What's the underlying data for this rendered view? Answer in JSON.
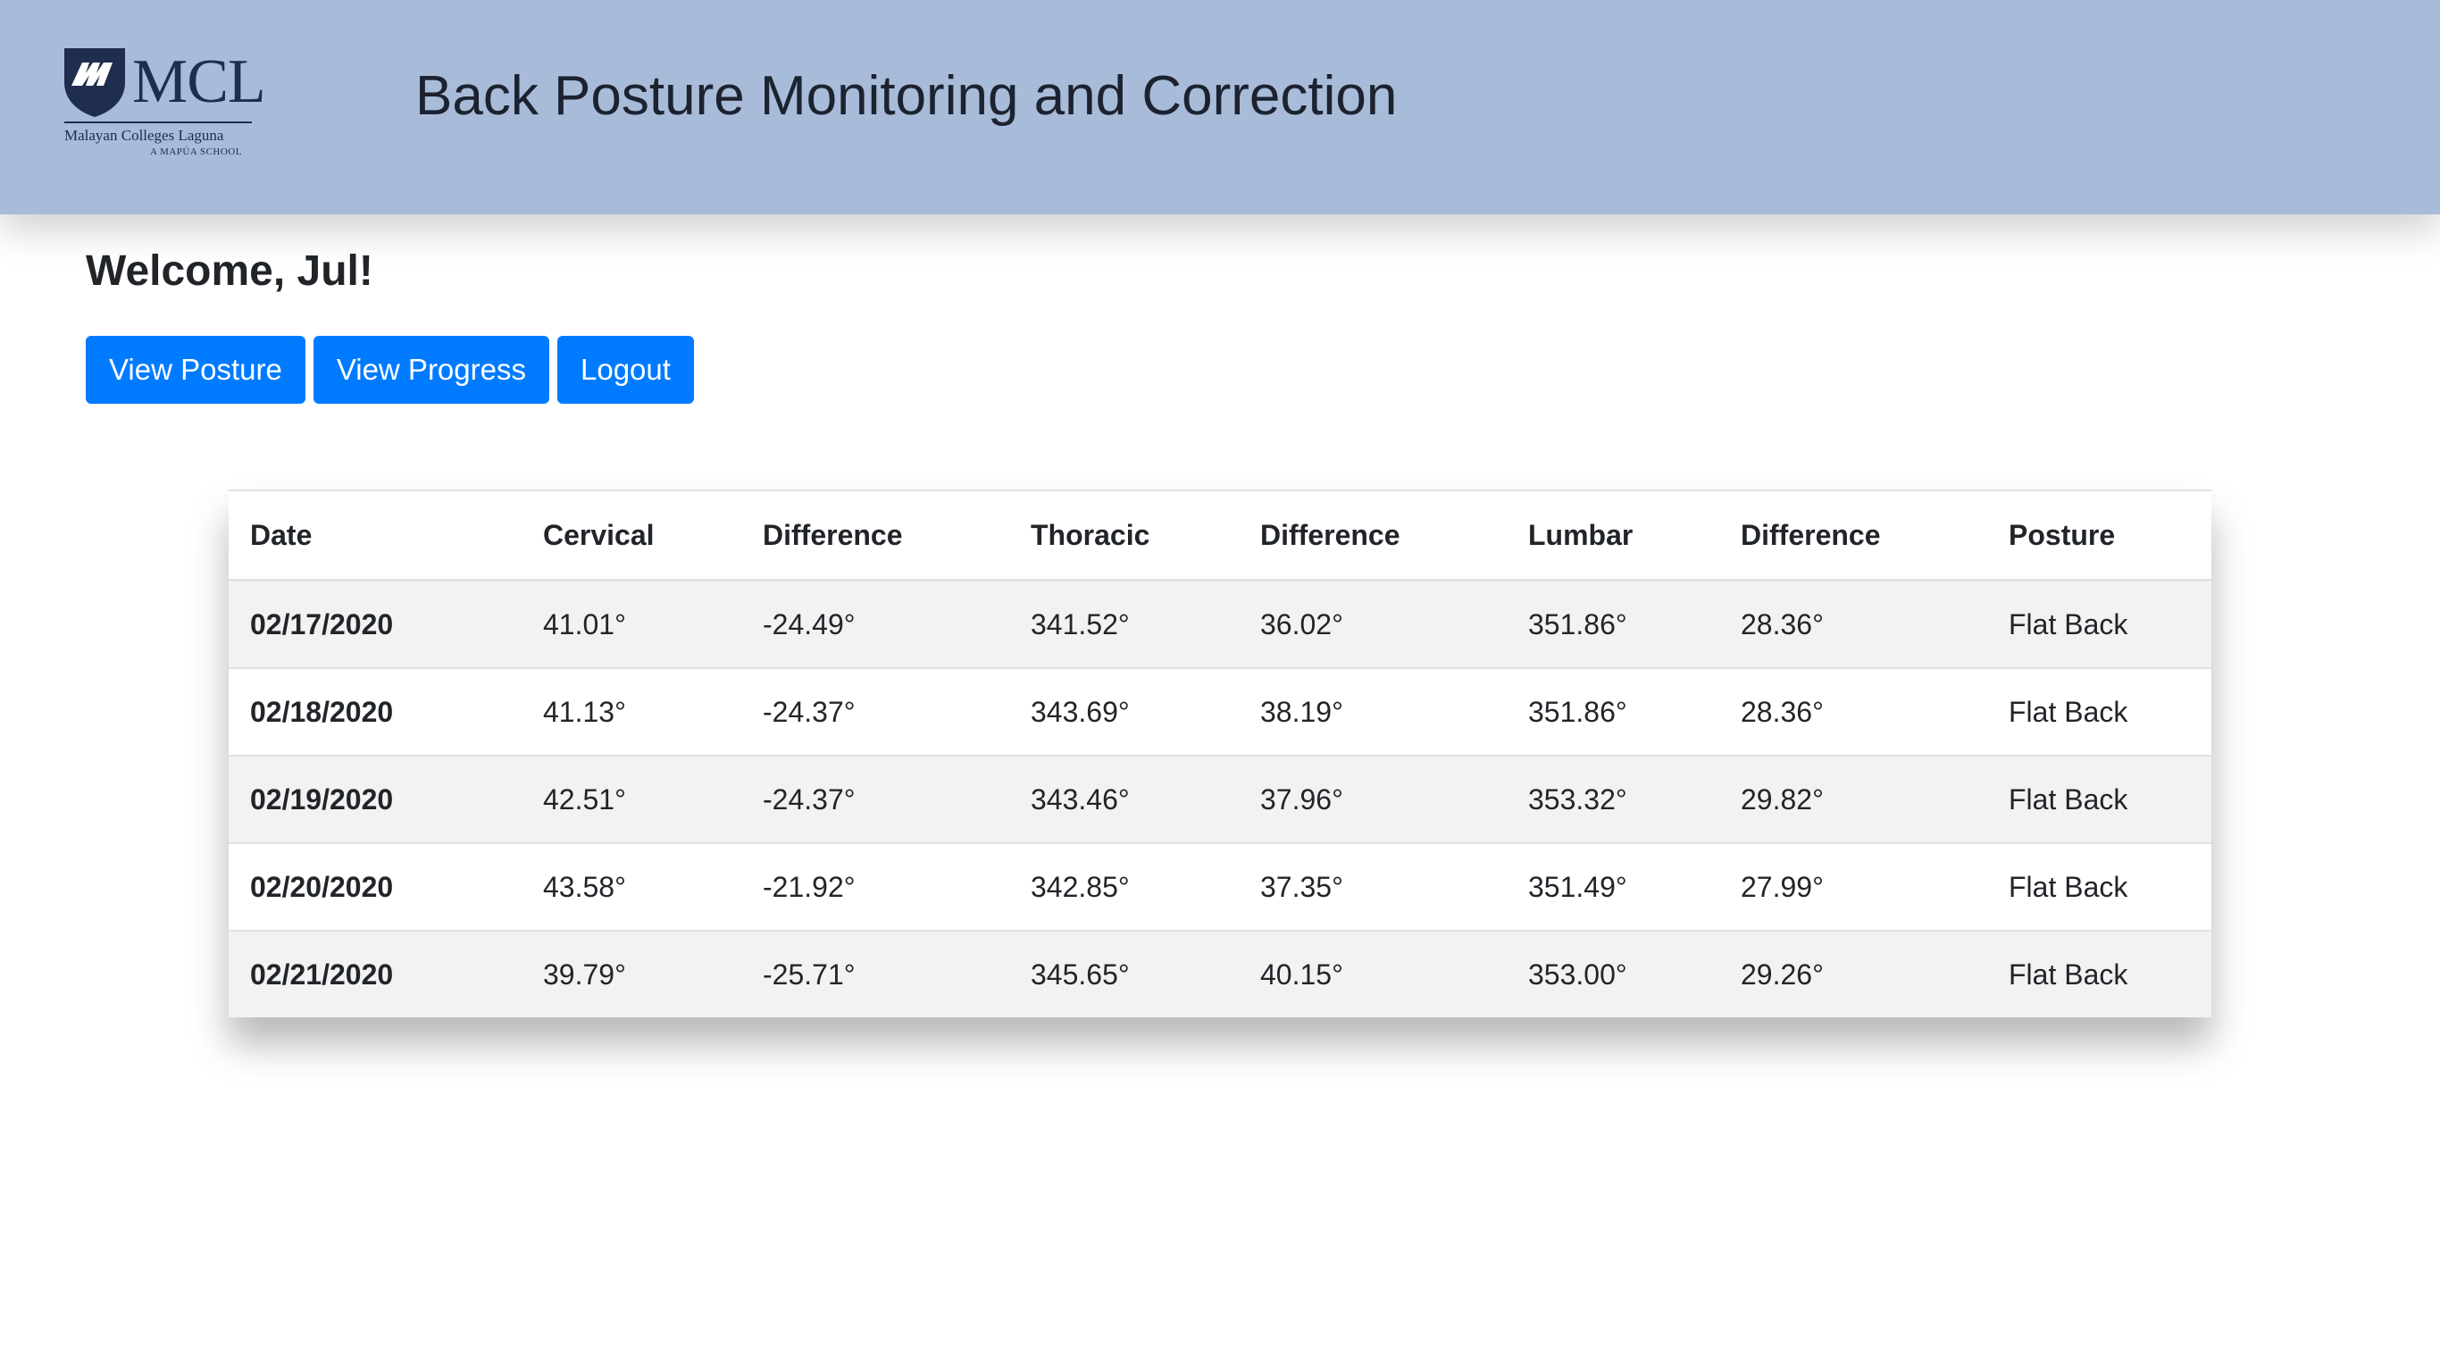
{
  "header": {
    "logo": {
      "wordmark": "MCL",
      "name": "Malayan Colleges Laguna",
      "tagline": "A MAPÚA SCHOOL",
      "colors": {
        "navy": "#1f2d4e",
        "background": "#a8bbd8"
      }
    },
    "title": "Back Posture Monitoring and Correction"
  },
  "welcome": "Welcome, Jul!",
  "actions": {
    "view_posture": "View Posture",
    "view_progress": "View Progress",
    "logout": "Logout",
    "button_color": "#007bff"
  },
  "table": {
    "columns": [
      "Date",
      "Cervical",
      "Difference",
      "Thoracic",
      "Difference",
      "Lumbar",
      "Difference",
      "Posture"
    ],
    "rows": [
      [
        "02/17/2020",
        "41.01°",
        "-24.49°",
        "341.52°",
        "36.02°",
        "351.86°",
        "28.36°",
        "Flat Back"
      ],
      [
        "02/18/2020",
        "41.13°",
        "-24.37°",
        "343.69°",
        "38.19°",
        "351.86°",
        "28.36°",
        "Flat Back"
      ],
      [
        "02/19/2020",
        "42.51°",
        "-24.37°",
        "343.46°",
        "37.96°",
        "353.32°",
        "29.82°",
        "Flat Back"
      ],
      [
        "02/20/2020",
        "43.58°",
        "-21.92°",
        "342.85°",
        "37.35°",
        "351.49°",
        "27.99°",
        "Flat Back"
      ],
      [
        "02/21/2020",
        "39.79°",
        "-25.71°",
        "345.65°",
        "40.15°",
        "353.00°",
        "29.26°",
        "Flat Back"
      ]
    ]
  }
}
